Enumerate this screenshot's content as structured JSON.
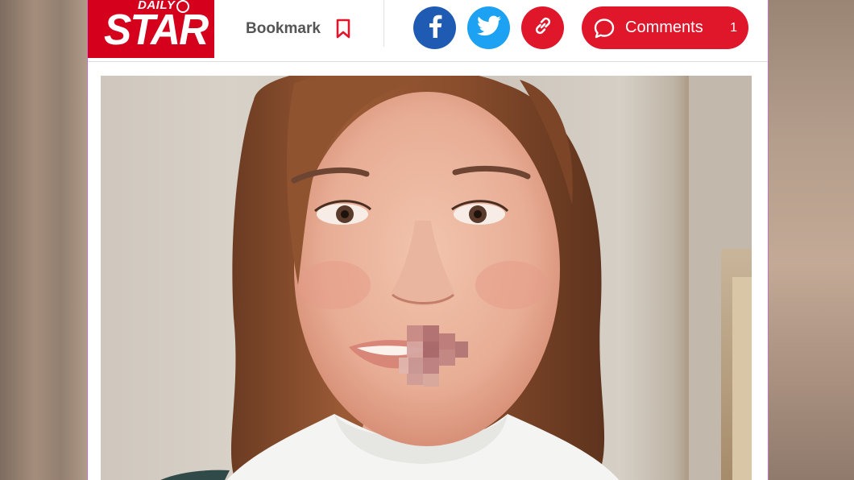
{
  "brand": {
    "small_text": "DAILY",
    "name": "STAR",
    "color": "#d4001c"
  },
  "header": {
    "bookmark_label": "Bookmark",
    "bookmark_icon": "bookmark-icon",
    "share": [
      {
        "name": "facebook",
        "icon": "facebook-icon",
        "color": "#1f5bb2"
      },
      {
        "name": "twitter",
        "icon": "twitter-icon",
        "color": "#1da1f2"
      },
      {
        "name": "copy-link",
        "icon": "link-icon",
        "color": "#e0162b"
      }
    ],
    "comments_label": "Comments",
    "comments_count": "1",
    "comments_icon": "speech-bubble-icon"
  },
  "photo": {
    "subject": "portrait photo",
    "accent": "#e0162b"
  }
}
